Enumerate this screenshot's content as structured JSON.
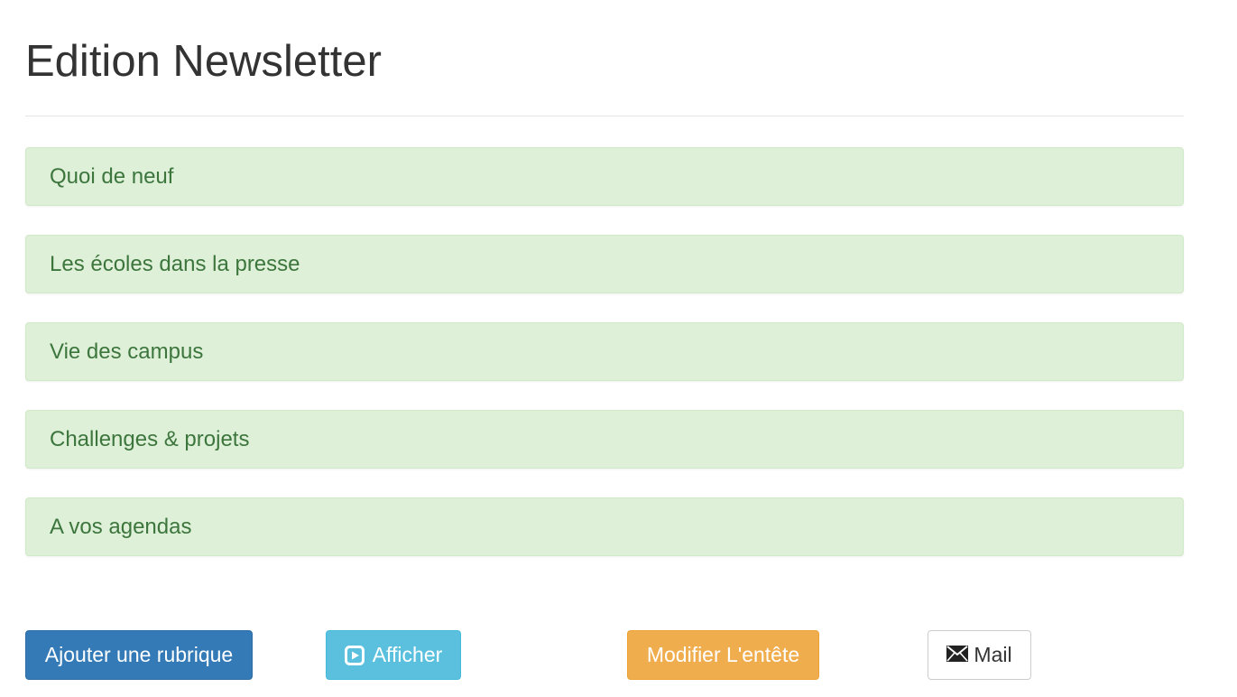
{
  "page": {
    "title": "Edition Newsletter"
  },
  "sections": [
    {
      "label": "Quoi de neuf"
    },
    {
      "label": "Les écoles dans la presse"
    },
    {
      "label": "Vie des campus"
    },
    {
      "label": "Challenges & projets"
    },
    {
      "label": "A vos agendas"
    }
  ],
  "actions": {
    "add_section_label": "Ajouter une rubrique",
    "show_label": "Afficher",
    "show_icon": "play-square-icon",
    "edit_header_label": "Modifier L'entête",
    "mail_label": "Mail",
    "mail_icon": "envelope-icon"
  },
  "colors": {
    "primary": "#337ab7",
    "info": "#5bc0de",
    "warning": "#f0ad4e",
    "section_bg": "#dff0d8",
    "section_text": "#3c763d"
  }
}
